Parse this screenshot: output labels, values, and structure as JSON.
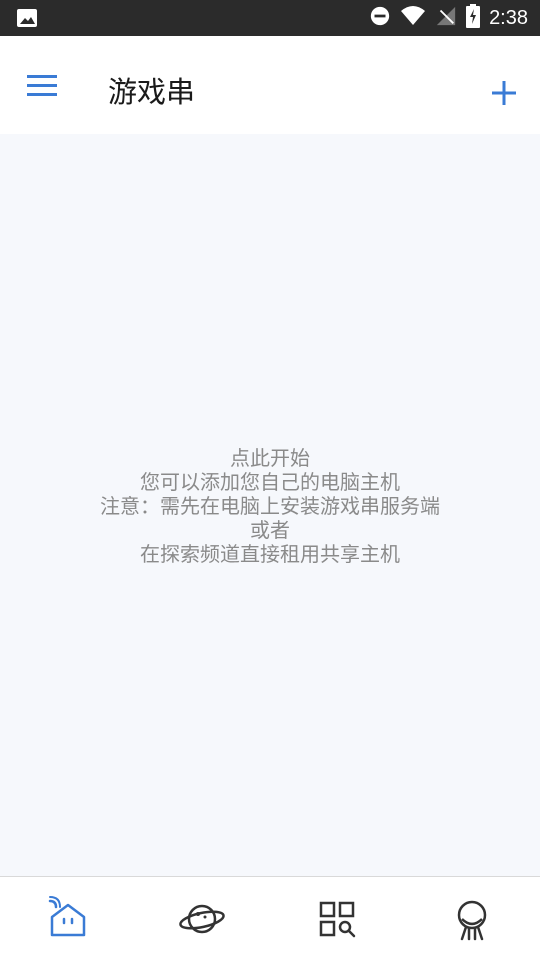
{
  "status_bar": {
    "time": "2:38",
    "icons": [
      "image-notification-icon",
      "do-not-disturb-icon",
      "wifi-icon",
      "no-signal-icon",
      "battery-charging-icon"
    ]
  },
  "app_bar": {
    "title": "游戏串",
    "menu_icon": "hamburger-menu-icon",
    "add_icon": "plus-icon",
    "accent_color": "#3a7bd5"
  },
  "empty_state": {
    "line1": "点此开始",
    "line2": "您可以添加您自己的电脑主机",
    "line3": "注意：需先在电脑上安装游戏串服务端",
    "line4": "或者",
    "line5": "在探索频道直接租用共享主机"
  },
  "bottom_nav": {
    "items": [
      {
        "name": "home",
        "icon": "home-wifi-icon",
        "active": true
      },
      {
        "name": "explore",
        "icon": "planet-icon",
        "active": false
      },
      {
        "name": "apps",
        "icon": "grid-search-icon",
        "active": false
      },
      {
        "name": "profile",
        "icon": "person-icon",
        "active": false
      }
    ],
    "active_color": "#3a7bd5",
    "inactive_color": "#333333"
  }
}
